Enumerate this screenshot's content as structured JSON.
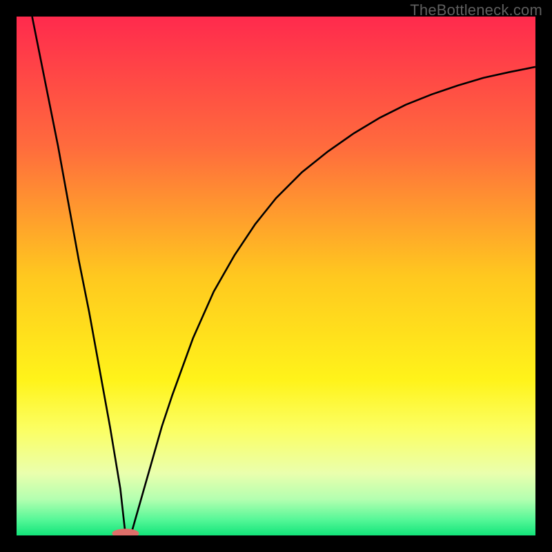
{
  "watermark": "TheBottleneck.com",
  "chart_data": {
    "type": "line",
    "title": "",
    "xlabel": "",
    "ylabel": "",
    "xlim": [
      0,
      100
    ],
    "ylim": [
      0,
      100
    ],
    "series": [
      {
        "name": "bottleneck-curve",
        "x": [
          3,
          5,
          8,
          10,
          12,
          14,
          16,
          18,
          19,
          20,
          21,
          22,
          24,
          26,
          28,
          30,
          34,
          38,
          42,
          46,
          50,
          55,
          60,
          65,
          70,
          75,
          80,
          85,
          90,
          95,
          100
        ],
        "y": [
          100,
          90,
          75,
          64,
          53,
          43,
          32,
          21,
          15,
          9,
          0,
          0,
          7,
          14,
          21,
          27,
          38,
          47,
          54,
          60,
          65,
          70,
          74,
          77.5,
          80.5,
          83,
          85,
          86.7,
          88.2,
          89.3,
          90.3
        ]
      }
    ],
    "gradient_stops": [
      {
        "offset": 0.0,
        "color": "#ff2a4d"
      },
      {
        "offset": 0.25,
        "color": "#ff6b3d"
      },
      {
        "offset": 0.5,
        "color": "#ffc81f"
      },
      {
        "offset": 0.7,
        "color": "#fff31a"
      },
      {
        "offset": 0.8,
        "color": "#fbff66"
      },
      {
        "offset": 0.88,
        "color": "#eaffad"
      },
      {
        "offset": 0.93,
        "color": "#b4ffb0"
      },
      {
        "offset": 0.97,
        "color": "#55f797"
      },
      {
        "offset": 1.0,
        "color": "#12e47a"
      }
    ],
    "sweet_spot_marker": {
      "x_center": 21,
      "x_halfwidth": 2.6,
      "y": 0.4,
      "ry": 0.9,
      "color": "#de6f6a"
    }
  }
}
